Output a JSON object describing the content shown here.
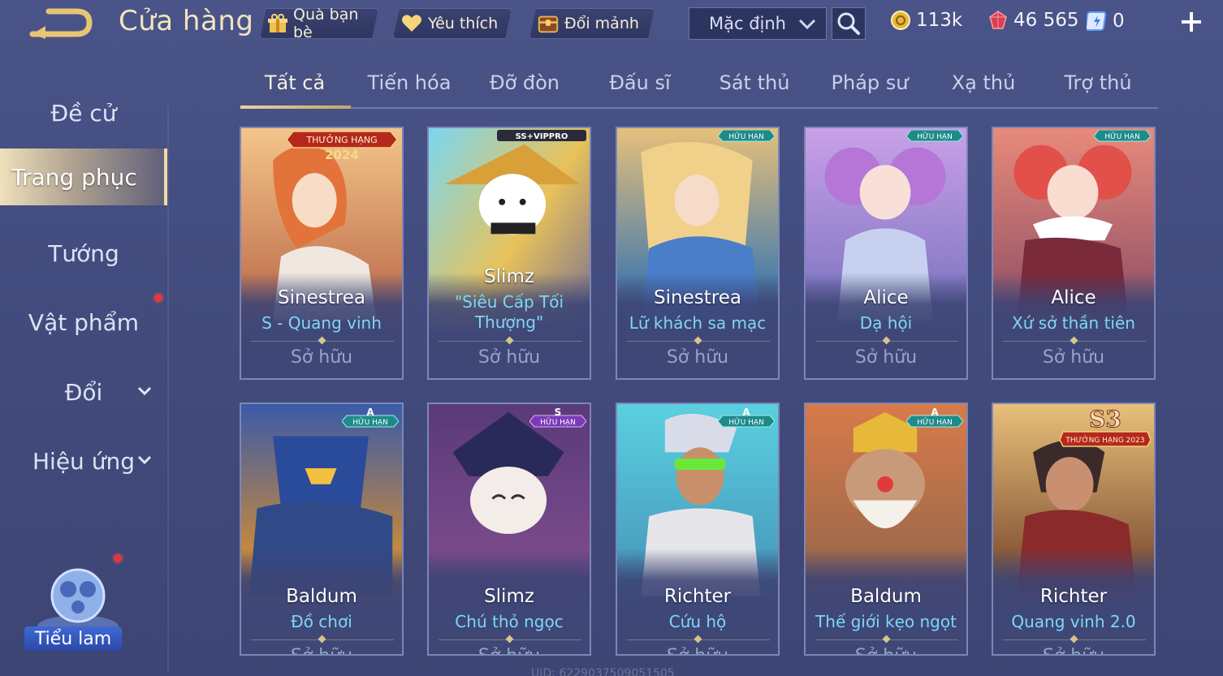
{
  "header": {
    "title": "Cửa hàng",
    "gift_label": "Quà bạn bè",
    "favorite_label": "Yêu thích",
    "exchange_label": "Đổi mảnh",
    "sort_value": "Mặc định",
    "gold": "113k",
    "rubies": "46 565",
    "vouchers": "0"
  },
  "sidebar": {
    "items": [
      {
        "label": "Đề cử"
      },
      {
        "label": "Trang phục"
      },
      {
        "label": "Tướng"
      },
      {
        "label": "Vật phẩm"
      },
      {
        "label": "Đổi"
      },
      {
        "label": "Hiệu ứng"
      }
    ],
    "pet_label": "Tiểu lam"
  },
  "tabs": [
    "Tất cả",
    "Tiến hóa",
    "Đỡ đòn",
    "Đấu sĩ",
    "Sát thủ",
    "Pháp sư",
    "Xạ thủ",
    "Trợ thủ"
  ],
  "cards": [
    {
      "hero": "Sinestrea",
      "skin": "S - Quang vinh",
      "status": "Sở hữu",
      "badge_line1": "THƯỞNG HẠNG",
      "badge_line2": "2024"
    },
    {
      "hero": "Slimz",
      "skin": "\"Siêu Cấp Tối Thượng\"",
      "status": "Sở hữu",
      "badge_line1": "SS+VIPPRO",
      "badge_line2": ""
    },
    {
      "hero": "Sinestrea",
      "skin": "Lữ khách sa mạc",
      "status": "Sở hữu",
      "badge_line1": "HỮU HẠN",
      "badge_line2": ""
    },
    {
      "hero": "Alice",
      "skin": "Dạ hội",
      "status": "Sở hữu",
      "badge_line1": "HỮU HẠN",
      "badge_line2": ""
    },
    {
      "hero": "Alice",
      "skin": "Xứ sở thần tiên",
      "status": "Sở hữu",
      "badge_line1": "HỮU HẠN",
      "badge_line2": ""
    },
    {
      "hero": "Baldum",
      "skin": "Đồ chơi",
      "status": "Sở hữu",
      "badge_line1": "A",
      "badge_line2": "HỮU HẠN"
    },
    {
      "hero": "Slimz",
      "skin": "Chú thỏ ngọc",
      "status": "Sở hữu",
      "badge_line1": "S",
      "badge_line2": "HỮU HẠN"
    },
    {
      "hero": "Richter",
      "skin": "Cứu hộ",
      "status": "Sở hữu",
      "badge_line1": "A",
      "badge_line2": "HỮU HẠN"
    },
    {
      "hero": "Baldum",
      "skin": "Thế giới kẹo ngọt",
      "status": "Sở hữu",
      "badge_line1": "A",
      "badge_line2": "HỮU HẠN"
    },
    {
      "hero": "Richter",
      "skin": "Quang vinh 2.0",
      "status": "Sở hữu",
      "badge_line1": "S3",
      "badge_line2": "THƯỞNG HẠNG 2023"
    }
  ],
  "uid_text": "UID: 6229037509051505",
  "colors": {
    "accent_gold": "#f0dba6",
    "skin_name": "#7fd6f5",
    "notification": "#e0383c"
  }
}
